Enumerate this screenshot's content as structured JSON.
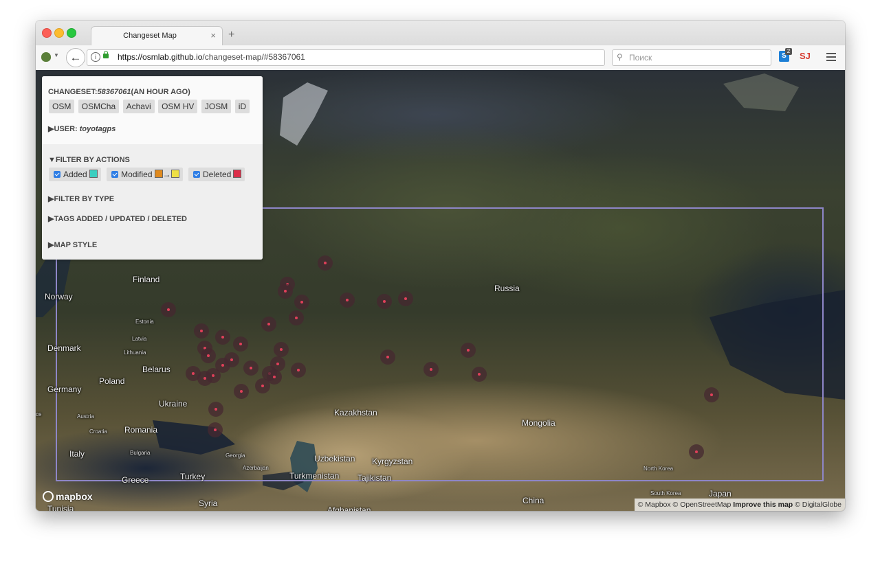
{
  "browser": {
    "tab_title": "Changeset Map",
    "tab_close": "×",
    "new_tab": "+",
    "url_domain": "https://osmlab.github.io",
    "url_path": "/changeset-map/#58367061",
    "search_placeholder": "Поиск",
    "ext_badge": "2",
    "ext1_letter": "S",
    "ext2_letter": "SJ"
  },
  "panel": {
    "changeset_label": "CHANGESET:",
    "changeset_id": "58367061",
    "changeset_time": "(AN HOUR AGO)",
    "buttons": [
      "OSM",
      "OSMCha",
      "Achavi",
      "OSM HV",
      "JOSM",
      "iD"
    ],
    "user_label": "▶USER:",
    "user_name": "toyotagps",
    "filter_actions": "▼FILTER BY ACTIONS",
    "actions": [
      {
        "label": "Added",
        "color": "#3ccfc0"
      },
      {
        "label": "Modified",
        "color": "#e08a1e",
        "color2": "#eee046"
      },
      {
        "label": "Deleted",
        "color": "#dc2f4a"
      }
    ],
    "modified_arrow": "→",
    "filter_type": "▶FILTER BY TYPE",
    "tags": "▶TAGS ADDED / UPDATED / DELETED",
    "map_style": "▶MAP STYLE"
  },
  "map": {
    "labels": {
      "finland": "Finland",
      "norway": "Norway",
      "russia": "Russia",
      "estonia": "Estonia",
      "latvia": "Latvia",
      "lithuania": "Lithuania",
      "denmark": "Denmark",
      "belarus": "Belarus",
      "poland": "Poland",
      "germany": "Germany",
      "ukraine": "Ukraine",
      "kazakhstan": "Kazakhstan",
      "mongolia": "Mongolia",
      "austria": "Austria",
      "croatia": "Croatia",
      "romania": "Romania",
      "italy": "Italy",
      "bulgaria": "Bulgaria",
      "georgia": "Georgia",
      "azerbaijan": "Azerbaijan",
      "uzbekistan": "Uzbekistan",
      "kyrgyzstan": "Kyrgyzstan",
      "turkmenistan": "Turkmenistan",
      "tajikistan": "Tajikistan",
      "greece": "Greece",
      "turkey": "Turkey",
      "syria": "Syria",
      "afghanistan": "Afghanistan",
      "tunisia": "Tunisia",
      "china": "China",
      "north_korea": "North Korea",
      "south_korea": "South Korea",
      "japan": "Japan",
      "ce": "ce"
    },
    "logo": "mapbox",
    "attribution_1": "© Mapbox © OpenStreetMap",
    "attribution_2": "Improve this map",
    "attribution_3": "© DigitalGlobe"
  }
}
